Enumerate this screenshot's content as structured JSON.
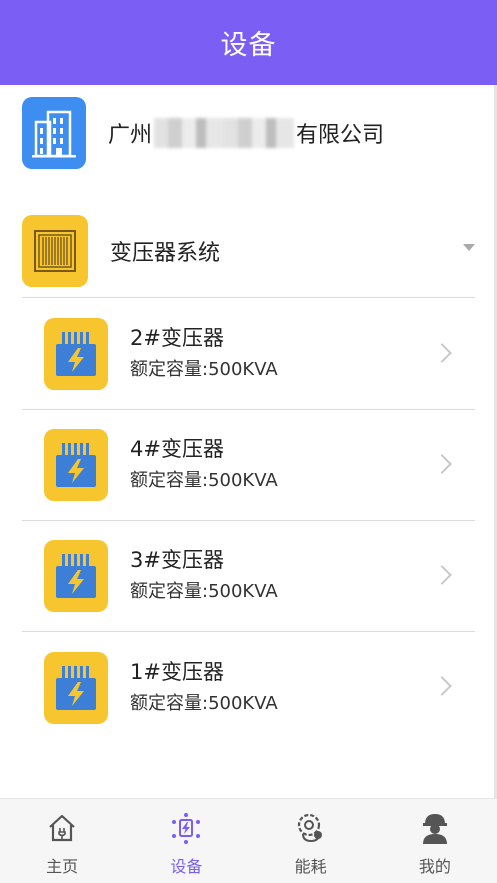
{
  "header": {
    "title": "设备"
  },
  "company": {
    "name_prefix": "广州",
    "name_suffix": "有限公司",
    "icon": "building-icon"
  },
  "system": {
    "label": "变压器系统",
    "icon": "transformer-core-icon"
  },
  "devices": [
    {
      "name": "2#变压器",
      "capacity": "额定容量:500KVA"
    },
    {
      "name": "4#变压器",
      "capacity": "额定容量:500KVA"
    },
    {
      "name": "3#变压器",
      "capacity": "额定容量:500KVA"
    },
    {
      "name": "1#变压器",
      "capacity": "额定容量:500KVA"
    }
  ],
  "tabs": [
    {
      "label": "主页",
      "icon": "home-icon",
      "active": false
    },
    {
      "label": "设备",
      "icon": "device-icon",
      "active": true
    },
    {
      "label": "能耗",
      "icon": "energy-icon",
      "active": false
    },
    {
      "label": "我的",
      "icon": "worker-icon",
      "active": false
    }
  ],
  "colors": {
    "primary": "#7b5ff5",
    "company_icon_bg": "#3d8ef0",
    "device_icon_bg": "#f7c52e",
    "transformer_body": "#3d7fd6"
  }
}
